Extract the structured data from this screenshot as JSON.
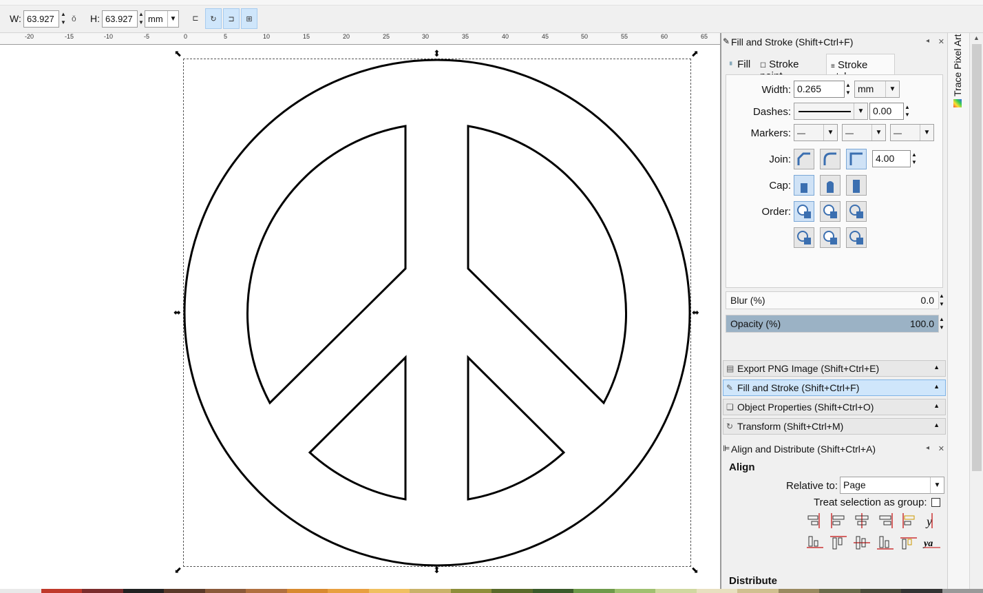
{
  "toolbar": {
    "w_label": "W:",
    "w_value": "63.927",
    "h_label": "H:",
    "h_value": "63.927",
    "unit": "mm"
  },
  "ruler": {
    "ticks": [
      "-20",
      "-15",
      "-10",
      "-5",
      "0",
      "5",
      "10",
      "15",
      "20",
      "25",
      "30",
      "35",
      "40",
      "45",
      "50",
      "55",
      "60",
      "65"
    ]
  },
  "fill_stroke": {
    "title": "Fill and Stroke (Shift+Ctrl+F)",
    "tabs": [
      {
        "label": "Fill"
      },
      {
        "label": "Stroke paint"
      },
      {
        "label": "Stroke style"
      }
    ],
    "width_label": "Width:",
    "width_value": "0.265",
    "width_unit": "mm",
    "dashes_label": "Dashes:",
    "dashes_offset": "0.00",
    "markers_label": "Markers:",
    "join_label": "Join:",
    "miter_value": "4.00",
    "cap_label": "Cap:",
    "order_label": "Order:",
    "blur_label": "Blur (%)",
    "blur_value": "0.0",
    "opacity_label": "Opacity (%)",
    "opacity_value": "100.0"
  },
  "accordion": [
    {
      "label": "Export PNG Image (Shift+Ctrl+E)",
      "active": false
    },
    {
      "label": "Fill and Stroke (Shift+Ctrl+F)",
      "active": true
    },
    {
      "label": "Object Properties (Shift+Ctrl+O)",
      "active": false
    },
    {
      "label": "Transform (Shift+Ctrl+M)",
      "active": false
    }
  ],
  "align": {
    "title": "Align and Distribute (Shift+Ctrl+A)",
    "section_align": "Align",
    "relative_to_label": "Relative to:",
    "relative_to_value": "Page",
    "treat_group_label": "Treat selection as group:",
    "section_distribute": "Distribute"
  },
  "side_tab": {
    "label": "Trace Pixel Art"
  },
  "colors": {
    "selected_button": "#cfe2f6",
    "active_accordion": "#cfe6fb",
    "opacity_fill": "#9bb2c5"
  }
}
